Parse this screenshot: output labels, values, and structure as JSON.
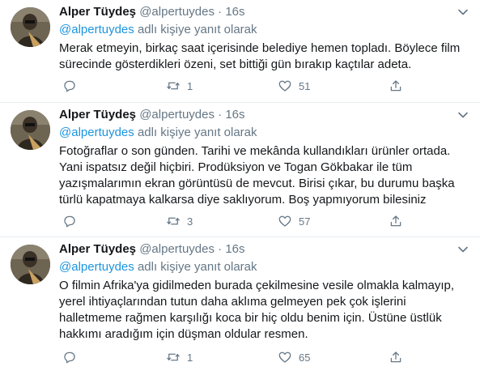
{
  "tweets": [
    {
      "display_name": "Alper Tüydeş",
      "handle": "@alpertuydes",
      "dot": "·",
      "time": "16s",
      "reply_mention": "@alpertuydes",
      "reply_suffix": " adlı kişiye yanıt olarak",
      "lines": [
        "Merak etmeyin, birkaç saat içerisinde belediye hemen topladı. Böylece film",
        "sürecinde gösterdikleri özeni, set bittiği gün bırakıp kaçtılar adeta."
      ],
      "reply_count": "",
      "retweet_count": "1",
      "like_count": "51"
    },
    {
      "display_name": "Alper Tüydeş",
      "handle": "@alpertuydes",
      "dot": "·",
      "time": "16s",
      "reply_mention": "@alpertuydes",
      "reply_suffix": " adlı kişiye yanıt olarak",
      "lines": [
        "Fotoğraflar o son günden. Tarihi ve mekânda kullandıkları ürünler ortada.",
        "Yani ispatsız değil hiçbiri. Prodüksiyon ve Togan Gökbakar ile tüm",
        "yazışmalarımın ekran görüntüsü de mevcut. Birisi çıkar, bu durumu başka",
        "türlü kapatmaya kalkarsa diye saklıyorum. Boş yapmıyorum bilesiniz"
      ],
      "reply_count": "",
      "retweet_count": "3",
      "like_count": "57"
    },
    {
      "display_name": "Alper Tüydeş",
      "handle": "@alpertuydes",
      "dot": "·",
      "time": "16s",
      "reply_mention": "@alpertuydes",
      "reply_suffix": " adlı kişiye yanıt olarak",
      "lines": [
        "O filmin Afrika'ya gidilmeden burada çekilmesine vesile olmakla kalmayıp,",
        "yerel ihtiyaçlarından tutun daha aklıma gelmeyen pek çok işlerini",
        "halletmeme rağmen karşılığı koca bir hiç oldu benim için. Üstüne üstlük",
        "hakkımı aradığım için düşman oldular resmen."
      ],
      "reply_count": "",
      "retweet_count": "1",
      "like_count": "65"
    }
  ],
  "icons": {
    "reply": "reply-icon",
    "retweet": "retweet-icon",
    "like": "like-icon",
    "share": "share-icon",
    "caret": "chevron-down-icon"
  },
  "colors": {
    "text": "#14171a",
    "secondary": "#657786",
    "link": "#1b95e0",
    "divider": "#e6ecf0"
  }
}
